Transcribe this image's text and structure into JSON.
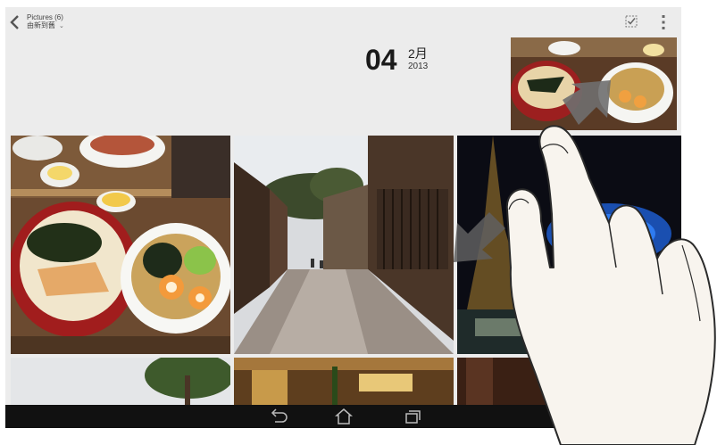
{
  "header": {
    "album_title": "Pictures (6)",
    "sort_label": "由新到舊"
  },
  "date_group": {
    "day": "04",
    "month": "2月",
    "year": "2013"
  },
  "photos": [
    {
      "name": "photo-ramen-bowls-small",
      "subject": "food"
    },
    {
      "name": "photo-ramen-bowls",
      "subject": "food"
    },
    {
      "name": "photo-old-street",
      "subject": "street"
    },
    {
      "name": "photo-night-lights",
      "subject": "night"
    },
    {
      "name": "photo-tree-sky",
      "subject": "tree"
    },
    {
      "name": "photo-restaurant",
      "subject": "restaurant"
    },
    {
      "name": "photo-dark-interior",
      "subject": "interior"
    }
  ],
  "navbar": {
    "buttons": [
      "back",
      "home",
      "recent-apps"
    ]
  },
  "icons": {
    "back": "chevron-left-icon",
    "select": "checkbox-select-icon",
    "more": "overflow-menu-icon"
  },
  "colors": {
    "background": "#ececec",
    "navbar": "#111111",
    "text": "#1a1a1a"
  }
}
